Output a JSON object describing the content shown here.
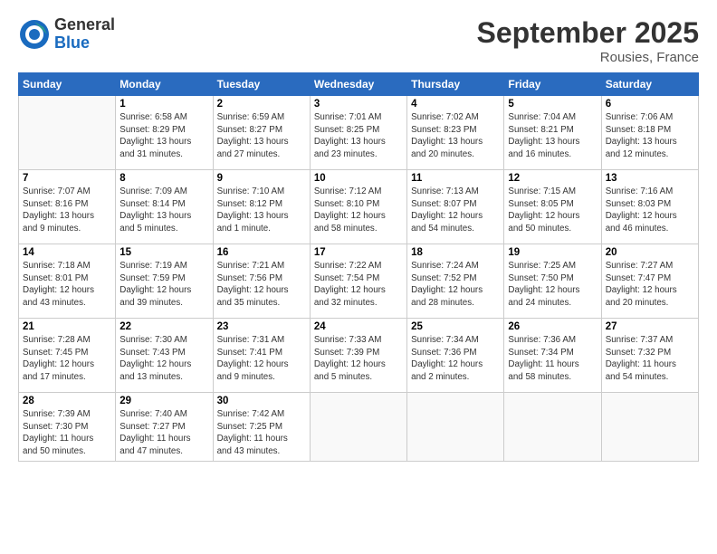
{
  "header": {
    "logo_general": "General",
    "logo_blue": "Blue",
    "month_year": "September 2025",
    "location": "Rousies, France"
  },
  "days_of_week": [
    "Sunday",
    "Monday",
    "Tuesday",
    "Wednesday",
    "Thursday",
    "Friday",
    "Saturday"
  ],
  "weeks": [
    [
      {
        "day": "",
        "info": ""
      },
      {
        "day": "1",
        "info": "Sunrise: 6:58 AM\nSunset: 8:29 PM\nDaylight: 13 hours\nand 31 minutes."
      },
      {
        "day": "2",
        "info": "Sunrise: 6:59 AM\nSunset: 8:27 PM\nDaylight: 13 hours\nand 27 minutes."
      },
      {
        "day": "3",
        "info": "Sunrise: 7:01 AM\nSunset: 8:25 PM\nDaylight: 13 hours\nand 23 minutes."
      },
      {
        "day": "4",
        "info": "Sunrise: 7:02 AM\nSunset: 8:23 PM\nDaylight: 13 hours\nand 20 minutes."
      },
      {
        "day": "5",
        "info": "Sunrise: 7:04 AM\nSunset: 8:21 PM\nDaylight: 13 hours\nand 16 minutes."
      },
      {
        "day": "6",
        "info": "Sunrise: 7:06 AM\nSunset: 8:18 PM\nDaylight: 13 hours\nand 12 minutes."
      }
    ],
    [
      {
        "day": "7",
        "info": "Sunrise: 7:07 AM\nSunset: 8:16 PM\nDaylight: 13 hours\nand 9 minutes."
      },
      {
        "day": "8",
        "info": "Sunrise: 7:09 AM\nSunset: 8:14 PM\nDaylight: 13 hours\nand 5 minutes."
      },
      {
        "day": "9",
        "info": "Sunrise: 7:10 AM\nSunset: 8:12 PM\nDaylight: 13 hours\nand 1 minute."
      },
      {
        "day": "10",
        "info": "Sunrise: 7:12 AM\nSunset: 8:10 PM\nDaylight: 12 hours\nand 58 minutes."
      },
      {
        "day": "11",
        "info": "Sunrise: 7:13 AM\nSunset: 8:07 PM\nDaylight: 12 hours\nand 54 minutes."
      },
      {
        "day": "12",
        "info": "Sunrise: 7:15 AM\nSunset: 8:05 PM\nDaylight: 12 hours\nand 50 minutes."
      },
      {
        "day": "13",
        "info": "Sunrise: 7:16 AM\nSunset: 8:03 PM\nDaylight: 12 hours\nand 46 minutes."
      }
    ],
    [
      {
        "day": "14",
        "info": "Sunrise: 7:18 AM\nSunset: 8:01 PM\nDaylight: 12 hours\nand 43 minutes."
      },
      {
        "day": "15",
        "info": "Sunrise: 7:19 AM\nSunset: 7:59 PM\nDaylight: 12 hours\nand 39 minutes."
      },
      {
        "day": "16",
        "info": "Sunrise: 7:21 AM\nSunset: 7:56 PM\nDaylight: 12 hours\nand 35 minutes."
      },
      {
        "day": "17",
        "info": "Sunrise: 7:22 AM\nSunset: 7:54 PM\nDaylight: 12 hours\nand 32 minutes."
      },
      {
        "day": "18",
        "info": "Sunrise: 7:24 AM\nSunset: 7:52 PM\nDaylight: 12 hours\nand 28 minutes."
      },
      {
        "day": "19",
        "info": "Sunrise: 7:25 AM\nSunset: 7:50 PM\nDaylight: 12 hours\nand 24 minutes."
      },
      {
        "day": "20",
        "info": "Sunrise: 7:27 AM\nSunset: 7:47 PM\nDaylight: 12 hours\nand 20 minutes."
      }
    ],
    [
      {
        "day": "21",
        "info": "Sunrise: 7:28 AM\nSunset: 7:45 PM\nDaylight: 12 hours\nand 17 minutes."
      },
      {
        "day": "22",
        "info": "Sunrise: 7:30 AM\nSunset: 7:43 PM\nDaylight: 12 hours\nand 13 minutes."
      },
      {
        "day": "23",
        "info": "Sunrise: 7:31 AM\nSunset: 7:41 PM\nDaylight: 12 hours\nand 9 minutes."
      },
      {
        "day": "24",
        "info": "Sunrise: 7:33 AM\nSunset: 7:39 PM\nDaylight: 12 hours\nand 5 minutes."
      },
      {
        "day": "25",
        "info": "Sunrise: 7:34 AM\nSunset: 7:36 PM\nDaylight: 12 hours\nand 2 minutes."
      },
      {
        "day": "26",
        "info": "Sunrise: 7:36 AM\nSunset: 7:34 PM\nDaylight: 11 hours\nand 58 minutes."
      },
      {
        "day": "27",
        "info": "Sunrise: 7:37 AM\nSunset: 7:32 PM\nDaylight: 11 hours\nand 54 minutes."
      }
    ],
    [
      {
        "day": "28",
        "info": "Sunrise: 7:39 AM\nSunset: 7:30 PM\nDaylight: 11 hours\nand 50 minutes."
      },
      {
        "day": "29",
        "info": "Sunrise: 7:40 AM\nSunset: 7:27 PM\nDaylight: 11 hours\nand 47 minutes."
      },
      {
        "day": "30",
        "info": "Sunrise: 7:42 AM\nSunset: 7:25 PM\nDaylight: 11 hours\nand 43 minutes."
      },
      {
        "day": "",
        "info": ""
      },
      {
        "day": "",
        "info": ""
      },
      {
        "day": "",
        "info": ""
      },
      {
        "day": "",
        "info": ""
      }
    ]
  ]
}
